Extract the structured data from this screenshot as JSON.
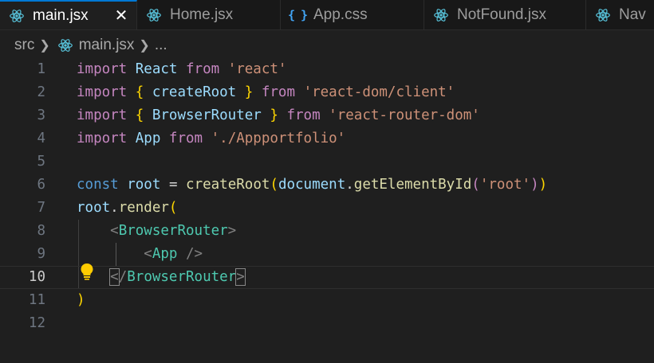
{
  "tabs": [
    {
      "label": "main.jsx",
      "icon": "react-icon",
      "active": true,
      "close": "✕"
    },
    {
      "label": "Home.jsx",
      "icon": "react-icon"
    },
    {
      "label": "App.css",
      "icon": "css-icon",
      "glyph": "{ }"
    },
    {
      "label": "NotFound.jsx",
      "icon": "react-icon"
    },
    {
      "label": "Nav",
      "icon": "react-icon"
    }
  ],
  "breadcrumb": {
    "folder": "src",
    "file": "main.jsx",
    "more": "..."
  },
  "editor": {
    "current_line": 10,
    "line_numbers": [
      "1",
      "2",
      "3",
      "4",
      "5",
      "6",
      "7",
      "8",
      "9",
      "10",
      "11",
      "12"
    ],
    "lines": {
      "l1": {
        "t1": "import",
        "t2": "React",
        "t3": "from",
        "t4": "'react'"
      },
      "l2": {
        "t1": "import",
        "t2": "{",
        "t3": "createRoot",
        "t4": "}",
        "t5": "from",
        "t6": "'react-dom/client'"
      },
      "l3": {
        "t1": "import",
        "t2": "{",
        "t3": "BrowserRouter",
        "t4": "}",
        "t5": "from",
        "t6": "'react-router-dom'"
      },
      "l4": {
        "t1": "import",
        "t2": "App",
        "t3": "from",
        "t4": "'./Appportfolio'"
      },
      "l6": {
        "t1": "const",
        "t2": "root",
        "t3": "=",
        "t4": "createRoot",
        "t5": "(",
        "t6": "document",
        "t7": ".",
        "t8": "getElementById",
        "t9": "(",
        "t10": "'root'",
        "t11": ")",
        "t12": ")"
      },
      "l7": {
        "t1": "root",
        "t2": ".",
        "t3": "render",
        "t4": "("
      },
      "l8": {
        "t1": "<",
        "t2": "BrowserRouter",
        "t3": ">"
      },
      "l9": {
        "t1": "<",
        "t2": "App",
        "t3": "/>"
      },
      "l10": {
        "t1": "<",
        "t2": "/",
        "t3": "BrowserRouter",
        "t4": ">"
      },
      "l11": {
        "t1": ")"
      }
    }
  },
  "colors": {
    "accent": "#0078d4",
    "background": "#1f1f1f",
    "lightbulb": "#ffcc00"
  }
}
